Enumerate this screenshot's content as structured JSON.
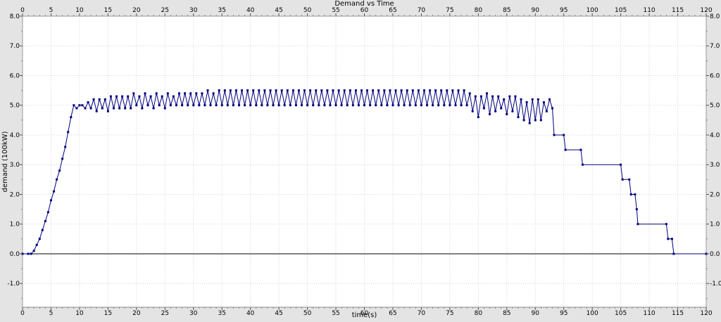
{
  "chart_data": {
    "type": "line",
    "title": "Demand vs Time",
    "xlabel": "time(s)",
    "ylabel": "demand (100kW)",
    "xlim": [
      0,
      120
    ],
    "ylim": [
      -1.8,
      8.0
    ],
    "xticks": [
      0,
      5,
      10,
      15,
      20,
      25,
      30,
      35,
      40,
      45,
      50,
      55,
      60,
      65,
      70,
      75,
      80,
      85,
      90,
      95,
      100,
      105,
      110,
      115,
      120
    ],
    "xtick_labels": [
      "0",
      "5",
      "10",
      "15",
      "20",
      "25",
      "30",
      "35",
      "40",
      "45",
      "50",
      "55",
      "60",
      "65",
      "70",
      "75",
      "80",
      "85",
      "90",
      "95",
      "100",
      "105",
      "110",
      "115",
      "120"
    ],
    "yticks": [
      -1.0,
      0.0,
      1.0,
      2.0,
      3.0,
      4.0,
      5.0,
      6.0,
      7.0,
      8.0
    ],
    "ytick_labels": [
      "-1.0",
      "0.0",
      "1.0",
      "2.0",
      "3.0",
      "4.0",
      "5.0",
      "6.0",
      "7.0",
      "8.0"
    ],
    "grid": true,
    "zero_line": true,
    "series_color": "#000080",
    "series": [
      {
        "x": [
          0,
          1,
          1.5,
          2,
          2.5,
          3,
          3.5,
          4,
          4.5,
          5,
          5.5,
          6,
          6.5,
          7,
          7.5,
          8,
          8.5,
          9,
          9.5,
          10,
          10.5,
          11,
          11.5,
          12,
          12.5,
          13,
          13.5,
          14,
          14.5,
          15,
          15.5,
          16,
          16.5,
          17,
          17.5,
          18,
          18.5,
          19,
          19.5,
          20,
          20.5,
          21,
          21.5,
          22,
          22.5,
          23,
          23.5,
          24,
          24.5,
          25,
          25.5,
          26,
          26.5,
          27,
          27.5,
          28,
          28.5,
          29,
          29.5,
          30,
          30.5,
          31,
          31.5,
          32,
          32.5,
          33,
          33.5,
          34,
          34.5,
          35,
          35.5,
          36,
          36.5,
          37,
          37.5,
          38,
          38.5,
          39,
          39.5,
          40,
          40.5,
          41,
          41.5,
          42,
          42.5,
          43,
          43.5,
          44,
          44.5,
          45,
          45.5,
          46,
          46.5,
          47,
          47.5,
          48,
          48.5,
          49,
          49.5,
          50,
          50.5,
          51,
          51.5,
          52,
          52.5,
          53,
          53.5,
          54,
          54.5,
          55,
          55.5,
          56,
          56.5,
          57,
          57.5,
          58,
          58.5,
          59,
          59.5,
          60,
          60.5,
          61,
          61.5,
          62,
          62.5,
          63,
          63.5,
          64,
          64.5,
          65,
          65.5,
          66,
          66.5,
          67,
          67.5,
          68,
          68.5,
          69,
          69.5,
          70,
          70.5,
          71,
          71.5,
          72,
          72.5,
          73,
          73.5,
          74,
          74.5,
          75,
          75.5,
          76,
          76.5,
          77,
          77.5,
          78,
          78.5,
          79,
          79.5,
          80,
          80.5,
          81,
          81.5,
          82,
          82.5,
          83,
          83.5,
          84,
          84.5,
          85,
          85.5,
          86,
          86.5,
          87,
          87.5,
          88,
          88.5,
          89,
          89.5,
          90,
          90.5,
          91,
          91.5,
          92,
          92.5,
          93,
          93.3,
          95,
          95.3,
          98,
          98.3,
          105,
          105.3,
          106.5,
          106.8,
          107.5,
          107.8,
          108,
          113,
          113.3,
          114,
          114.3,
          120
        ],
        "y": [
          0,
          0,
          0,
          0.1,
          0.3,
          0.5,
          0.8,
          1.1,
          1.4,
          1.8,
          2.1,
          2.5,
          2.8,
          3.2,
          3.6,
          4.1,
          4.6,
          5.0,
          4.9,
          5.0,
          5.0,
          4.9,
          5.1,
          4.9,
          5.2,
          4.8,
          5.2,
          4.9,
          5.2,
          4.8,
          5.3,
          4.9,
          5.3,
          4.9,
          5.3,
          4.9,
          5.3,
          4.9,
          5.4,
          5.0,
          5.3,
          4.9,
          5.4,
          5.0,
          5.3,
          4.9,
          5.4,
          5.0,
          5.3,
          4.9,
          5.4,
          5.0,
          5.3,
          5.0,
          5.4,
          5.0,
          5.4,
          5.0,
          5.4,
          5.0,
          5.4,
          5.0,
          5.4,
          5.0,
          5.5,
          5.0,
          5.4,
          5.0,
          5.5,
          5.0,
          5.5,
          5.0,
          5.5,
          5.0,
          5.5,
          5.0,
          5.5,
          5.0,
          5.5,
          5.0,
          5.5,
          5.0,
          5.5,
          5.0,
          5.5,
          5.0,
          5.5,
          5.0,
          5.5,
          5.0,
          5.5,
          5.0,
          5.5,
          5.0,
          5.5,
          5.0,
          5.5,
          5.0,
          5.5,
          5.0,
          5.5,
          5.0,
          5.5,
          5.0,
          5.5,
          5.0,
          5.5,
          5.0,
          5.5,
          5.0,
          5.5,
          5.0,
          5.5,
          5.0,
          5.5,
          5.0,
          5.5,
          5.0,
          5.5,
          5.0,
          5.5,
          5.0,
          5.5,
          5.0,
          5.5,
          5.0,
          5.5,
          5.0,
          5.5,
          5.0,
          5.5,
          5.0,
          5.5,
          5.0,
          5.5,
          5.0,
          5.5,
          5.0,
          5.5,
          5.0,
          5.5,
          5.0,
          5.5,
          5.0,
          5.5,
          5.0,
          5.5,
          5.0,
          5.5,
          5.0,
          5.5,
          5.0,
          5.5,
          5.0,
          5.5,
          5.0,
          5.4,
          4.8,
          5.3,
          4.6,
          5.3,
          4.9,
          5.4,
          4.7,
          5.3,
          4.8,
          5.3,
          4.9,
          5.2,
          4.7,
          5.3,
          4.8,
          5.3,
          4.6,
          5.2,
          4.5,
          5.1,
          4.4,
          5.2,
          4.5,
          5.2,
          4.5,
          5.1,
          4.8,
          5.2,
          4.9,
          4.0,
          4.0,
          3.5,
          3.5,
          3.0,
          3.0,
          2.5,
          2.5,
          2.0,
          2.0,
          1.5,
          1.0,
          1.0,
          0.5,
          0.5,
          0,
          0
        ]
      }
    ]
  }
}
